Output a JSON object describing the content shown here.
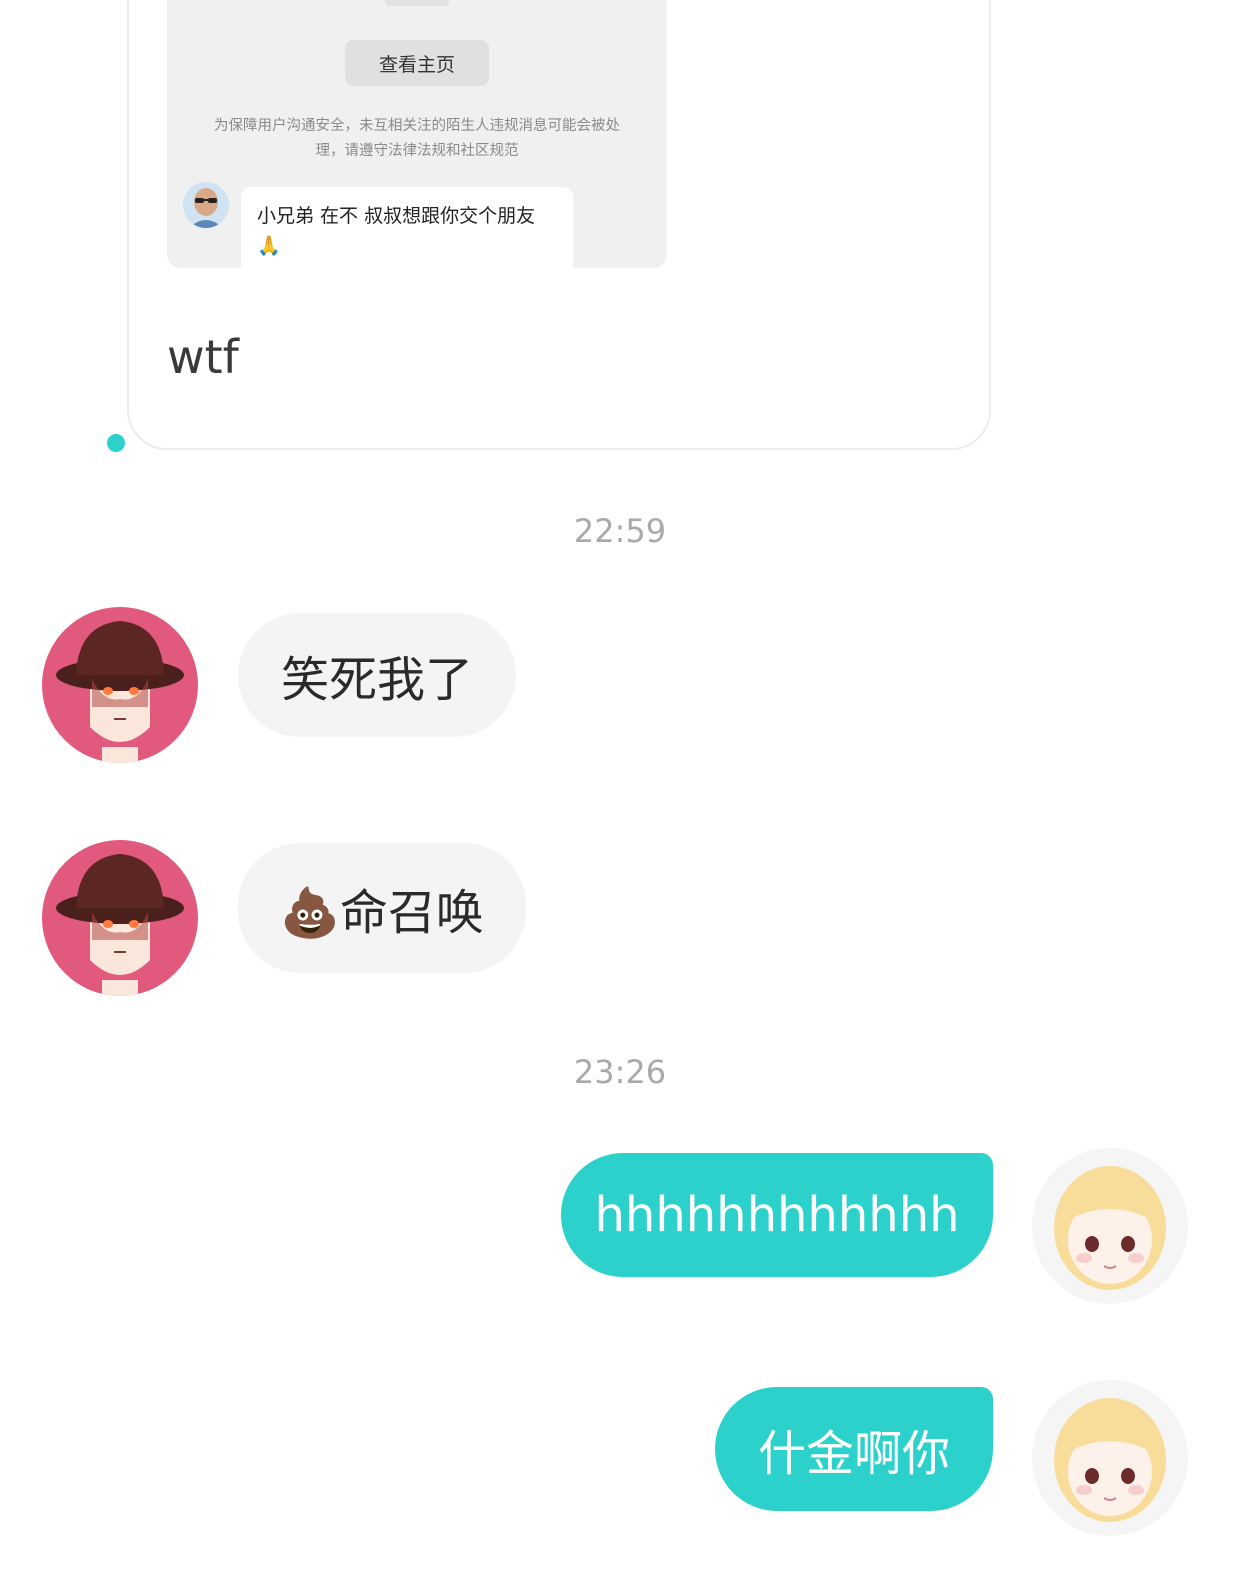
{
  "shared_card": {
    "view_profile_label": "查看主页",
    "safety_notice": "为保障用户沟通安全，未互相关注的陌生人违规消息可能会被处理，请遵守法律法规和社区规范",
    "stranger_message": "小兄弟 在不 叔叔想跟你交个朋友",
    "stranger_emoji": "🙏"
  },
  "caption": "wtf",
  "messages": {
    "time_1": "22:59",
    "incoming_1": "笑死我了",
    "incoming_2": "💩命召唤",
    "time_2": "23:26",
    "outgoing_1": "hhhhhhhhhhhh",
    "outgoing_2": "什金啊你"
  },
  "colors": {
    "accent": "#2dd1cc",
    "incoming_bubble": "#f4f4f4",
    "timestamp": "#a9a9a9",
    "other_avatar_bg": "#e15a7e"
  },
  "icons": {
    "other_user_avatar": "anime-boy-bucket-hat",
    "my_avatar": "cartoon-blonde-girl",
    "stranger_avatar": "bald-man-sunglasses"
  }
}
